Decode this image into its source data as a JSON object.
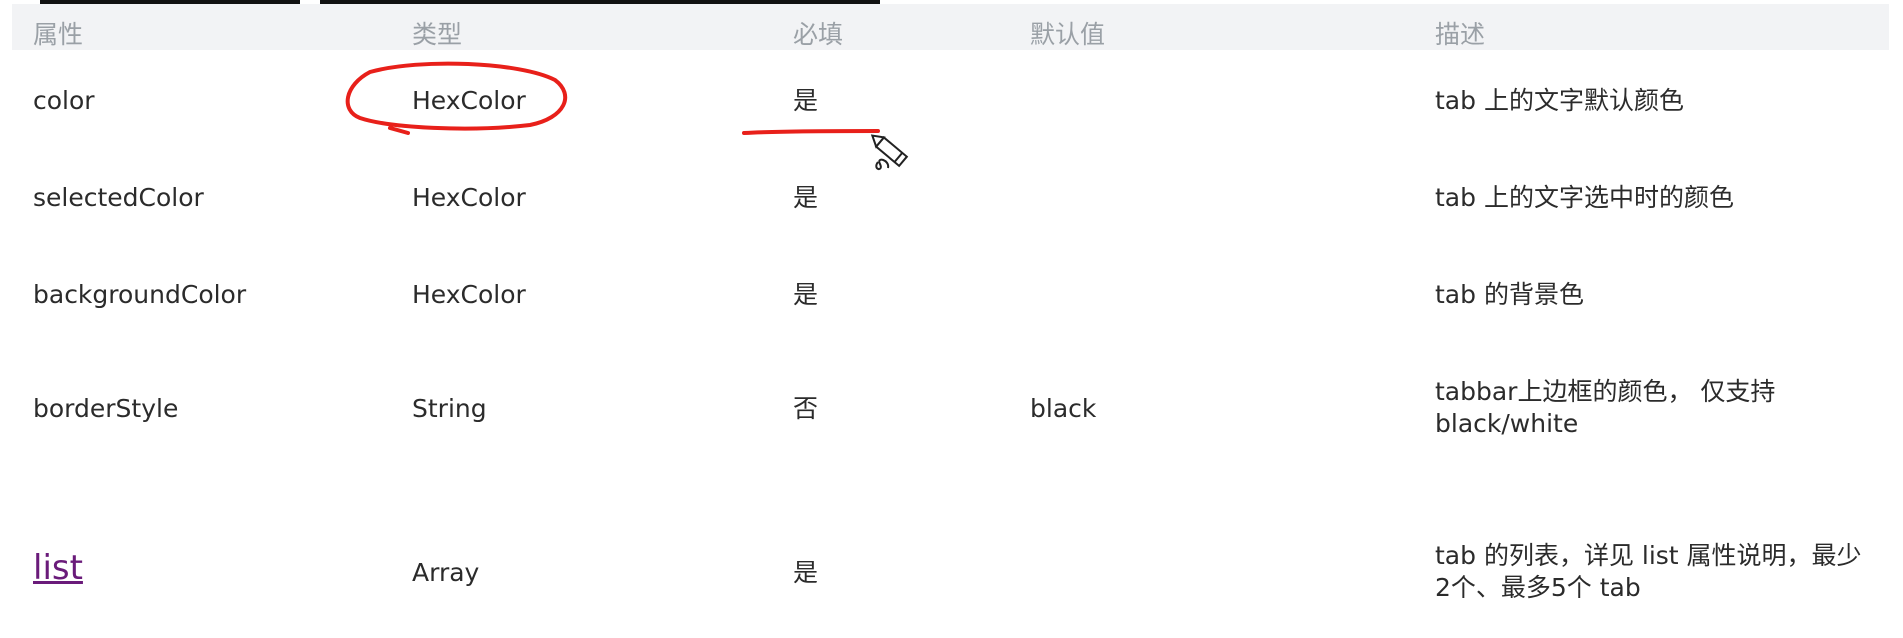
{
  "header": {
    "col_attr": "属性",
    "col_type": "类型",
    "col_required": "必填",
    "col_default": "默认值",
    "col_desc": "描述"
  },
  "rows": [
    {
      "attr": "color",
      "type": "HexColor",
      "required": "是",
      "default": "",
      "desc": "tab 上的文字默认颜色"
    },
    {
      "attr": "selectedColor",
      "type": "HexColor",
      "required": "是",
      "default": "",
      "desc": "tab 上的文字选中时的颜色"
    },
    {
      "attr": "backgroundColor",
      "type": "HexColor",
      "required": "是",
      "default": "",
      "desc": "tab 的背景色"
    },
    {
      "attr": "borderStyle",
      "type": "String",
      "required": "否",
      "default": "black",
      "desc": "tabbar上边框的颜色， 仅支持 black/white"
    },
    {
      "attr": "list",
      "type": "Array",
      "required": "是",
      "default": "",
      "desc": "tab 的列表，详见 list 属性说明，最少2个、最多5个 tab"
    }
  ],
  "colors": {
    "header_bg": "#f2f3f5",
    "header_text": "#9aa0a6",
    "link": "#6a1b7a",
    "annotation": "#e8201a"
  },
  "icons": [
    "pencil-cursor-icon"
  ]
}
